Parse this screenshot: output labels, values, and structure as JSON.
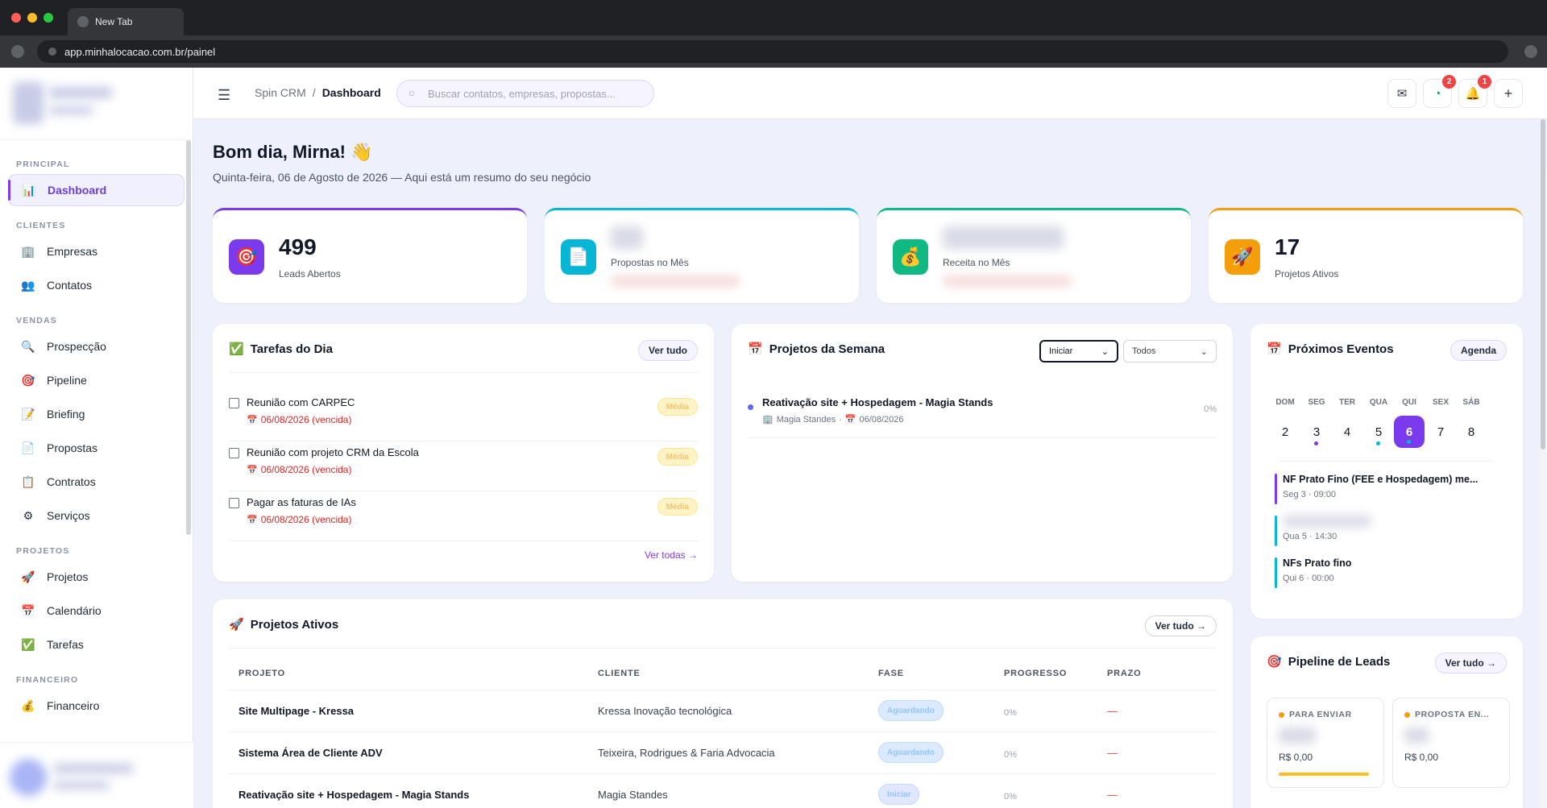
{
  "browser": {
    "tab_title": "New Tab",
    "url": "app.minhalocacao.com.br/painel"
  },
  "sidebar": {
    "sections": [
      {
        "label": "PRINCIPAL",
        "items": [
          {
            "label": "Dashboard",
            "icon": "chart-icon",
            "glyph": "📊",
            "active": true
          }
        ]
      },
      {
        "label": "CLIENTES",
        "items": [
          {
            "label": "Empresas",
            "icon": "building-icon",
            "glyph": "🏢"
          },
          {
            "label": "Contatos",
            "icon": "people-icon",
            "glyph": "👥"
          }
        ]
      },
      {
        "label": "VENDAS",
        "items": [
          {
            "label": "Prospecção",
            "icon": "magnifier-icon",
            "glyph": "🔍"
          },
          {
            "label": "Pipeline",
            "icon": "target-icon",
            "glyph": "🎯"
          },
          {
            "label": "Briefing",
            "icon": "memo-icon",
            "glyph": "📝"
          },
          {
            "label": "Propostas",
            "icon": "document-icon",
            "glyph": "📄"
          },
          {
            "label": "Contratos",
            "icon": "clipboard-icon",
            "glyph": "📋"
          },
          {
            "label": "Serviços",
            "icon": "gear-icon",
            "glyph": "⚙"
          }
        ]
      },
      {
        "label": "PROJETOS",
        "items": [
          {
            "label": "Projetos",
            "icon": "rocket-icon",
            "glyph": "🚀"
          },
          {
            "label": "Calendário",
            "icon": "calendar-icon",
            "glyph": "📅"
          },
          {
            "label": "Tarefas",
            "icon": "checkbox-icon",
            "glyph": "✅"
          }
        ]
      },
      {
        "label": "FINANCEIRO",
        "items": [
          {
            "label": "Financeiro",
            "icon": "money-bag-icon",
            "glyph": "💰"
          }
        ]
      }
    ]
  },
  "topbar": {
    "breadcrumb_root": "Spin CRM",
    "breadcrumb_sep": "/",
    "breadcrumb_current": "Dashboard",
    "search_placeholder": "Buscar contatos, empresas, propostas...",
    "whatsapp_badge": "2",
    "bell_badge": "1",
    "plus_label": "+"
  },
  "greeting": {
    "title": "Bom dia, Mirna! 👋",
    "subtitle": "Quinta-feira, 06 de Agosto de 2026 — Aqui está um resumo do seu negócio"
  },
  "stats": [
    {
      "value": "499",
      "label": "Leads Abertos",
      "glyph": "🎯",
      "accent": "#7c3aed",
      "icon_bg": "#7c3aed"
    },
    {
      "value": "",
      "label": "Propostas no Mês",
      "glyph": "📄",
      "accent": "#06b6d4",
      "icon_bg": "#06b6d4"
    },
    {
      "value": "",
      "label": "Receita no Mês",
      "glyph": "💰",
      "accent": "#10b981",
      "icon_bg": "#10b981"
    },
    {
      "value": "17",
      "label": "Projetos Ativos",
      "glyph": "🚀",
      "accent": "#f59e0b",
      "icon_bg": "#f59e0b"
    }
  ],
  "tasks": {
    "title": "Tarefas do Dia",
    "view_all_button": "Ver tudo",
    "footer_link": "Ver todas →",
    "items": [
      {
        "title": "Reunião com CARPEC",
        "date": "06/08/2026 (vencida)",
        "priority": "Média"
      },
      {
        "title": "Reunião com projeto CRM da Escola",
        "date": "06/08/2026 (vencida)",
        "priority": "Média"
      },
      {
        "title": "Pagar as faturas de IAs",
        "date": "06/08/2026 (vencida)",
        "priority": "Média"
      }
    ]
  },
  "week_projects": {
    "title": "Projetos da Semana",
    "filter_phase": "Iniciar",
    "filter_scope": "Todos",
    "items": [
      {
        "title": "Reativação site + Hospedagem - Magia Stands",
        "client": "Magia Standes",
        "date": "06/08/2026",
        "progress": "0%"
      }
    ]
  },
  "events": {
    "title": "Próximos Eventos",
    "agenda_button": "Agenda",
    "weekdays": [
      "DOM",
      "SEG",
      "TER",
      "QUA",
      "QUI",
      "SEX",
      "SÁB"
    ],
    "days": [
      "2",
      "3",
      "4",
      "5",
      "6",
      "7",
      "8"
    ],
    "today_index": 4,
    "items": [
      {
        "title": "NF Prato Fino (FEE e Hospedagem) me...",
        "when": "Seg 3 · 09:00",
        "color": "#7c3aed"
      },
      {
        "title": "",
        "when": "Qua 5 · 14:30",
        "color": "#06b6d4"
      },
      {
        "title": "NFs Prato fino",
        "when": "Qui 6 · 00:00",
        "color": "#06b6d4"
      }
    ]
  },
  "active_projects": {
    "title": "Projetos Ativos",
    "view_all_button": "Ver tudo →",
    "columns": [
      "PROJETO",
      "CLIENTE",
      "FASE",
      "PROGRESSO",
      "PRAZO"
    ],
    "rows": [
      {
        "project": "Site Multipage - Kressa",
        "client": "Kressa Inovação tecnológica",
        "phase": "Aguardando",
        "progress": "0%",
        "deadline": "—"
      },
      {
        "project": "Sistema Área de Cliente ADV",
        "client": "Teixeira, Rodrigues & Faria Advocacia",
        "phase": "Aguardando",
        "progress": "0%",
        "deadline": "—"
      },
      {
        "project": "Reativação site + Hospedagem - Magia Stands",
        "client": "Magia Standes",
        "phase": "Iniciar",
        "progress": "0%",
        "deadline": "—"
      }
    ]
  },
  "pipeline": {
    "title": "Pipeline de Leads",
    "view_all_button": "Ver tudo →",
    "stages": [
      {
        "label": "PARA ENVIAR",
        "value": "R$ 0,00",
        "dot_color": "#f59e0b"
      },
      {
        "label": "PROPOSTA EN...",
        "value": "R$ 0,00",
        "dot_color": "#f59e0b"
      }
    ]
  }
}
